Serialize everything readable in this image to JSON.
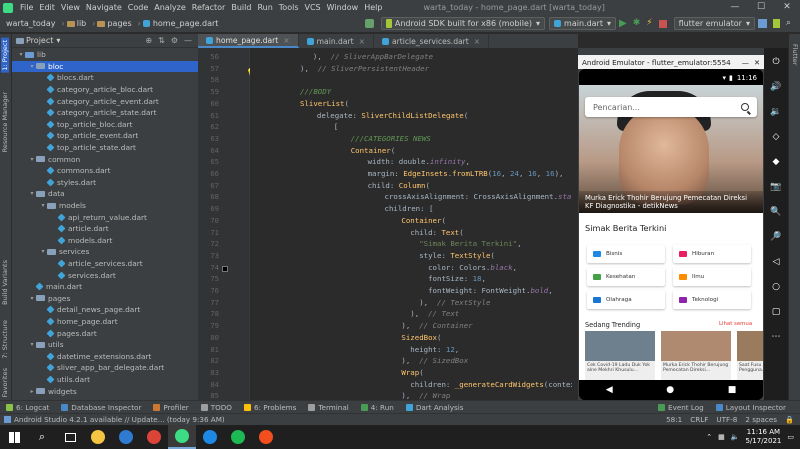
{
  "menu": {
    "items": [
      "File",
      "Edit",
      "View",
      "Navigate",
      "Code",
      "Analyze",
      "Refactor",
      "Build",
      "Run",
      "Tools",
      "VCS",
      "Window",
      "Help"
    ],
    "window_title": "warta_today - home_page.dart [warta_today]",
    "win_min": "—",
    "win_max": "☐",
    "win_close": "✕"
  },
  "nav": {
    "crumbs": [
      "warta_today",
      "lib",
      "pages",
      "home_page.dart"
    ],
    "device": "Android SDK built for x86 (mobile)",
    "run_config": "main.dart",
    "flutter_device": "flutter emulator"
  },
  "left_strip": {
    "project": "1: Project",
    "resource": "Resource Manager",
    "build_variants": "Build Variants",
    "structure": "7: Structure",
    "favorites": "2: Favorites"
  },
  "project_panel": {
    "title": "Project",
    "tree": [
      {
        "label": "lib",
        "kind": "folder-src",
        "indent": 1,
        "arrow": "▾"
      },
      {
        "label": "bloc",
        "kind": "folder",
        "indent": 2,
        "arrow": "▾",
        "selected": true
      },
      {
        "label": "blocs.dart",
        "kind": "dart",
        "indent": 3
      },
      {
        "label": "category_article_bloc.dart",
        "kind": "dart",
        "indent": 3
      },
      {
        "label": "category_article_event.dart",
        "kind": "dart",
        "indent": 3
      },
      {
        "label": "category_article_state.dart",
        "kind": "dart",
        "indent": 3
      },
      {
        "label": "top_article_bloc.dart",
        "kind": "dart",
        "indent": 3
      },
      {
        "label": "top_article_event.dart",
        "kind": "dart",
        "indent": 3
      },
      {
        "label": "top_article_state.dart",
        "kind": "dart",
        "indent": 3
      },
      {
        "label": "common",
        "kind": "folder",
        "indent": 2,
        "arrow": "▾"
      },
      {
        "label": "commons.dart",
        "kind": "dart",
        "indent": 3
      },
      {
        "label": "styles.dart",
        "kind": "dart",
        "indent": 3
      },
      {
        "label": "data",
        "kind": "folder",
        "indent": 2,
        "arrow": "▾"
      },
      {
        "label": "models",
        "kind": "folder",
        "indent": 3,
        "arrow": "▾"
      },
      {
        "label": "api_return_value.dart",
        "kind": "dart",
        "indent": 4
      },
      {
        "label": "article.dart",
        "kind": "dart",
        "indent": 4
      },
      {
        "label": "models.dart",
        "kind": "dart",
        "indent": 4
      },
      {
        "label": "services",
        "kind": "folder",
        "indent": 3,
        "arrow": "▾"
      },
      {
        "label": "article_services.dart",
        "kind": "dart",
        "indent": 4
      },
      {
        "label": "services.dart",
        "kind": "dart",
        "indent": 4
      },
      {
        "label": "main.dart",
        "kind": "dart",
        "indent": 2
      },
      {
        "label": "pages",
        "kind": "folder",
        "indent": 2,
        "arrow": "▾"
      },
      {
        "label": "detail_news_page.dart",
        "kind": "dart",
        "indent": 3
      },
      {
        "label": "home_page.dart",
        "kind": "dart",
        "indent": 3
      },
      {
        "label": "pages.dart",
        "kind": "dart",
        "indent": 3
      },
      {
        "label": "utils",
        "kind": "folder",
        "indent": 2,
        "arrow": "▾"
      },
      {
        "label": "datetime_extensions.dart",
        "kind": "dart",
        "indent": 3
      },
      {
        "label": "sliver_app_bar_delegate.dart",
        "kind": "dart",
        "indent": 3
      },
      {
        "label": "utils.dart",
        "kind": "dart",
        "indent": 3
      },
      {
        "label": "widgets",
        "kind": "folder",
        "indent": 2,
        "arrow": "▸"
      }
    ]
  },
  "editor": {
    "tabs": [
      {
        "label": "home_page.dart",
        "active": true
      },
      {
        "label": "main.dart",
        "active": false
      },
      {
        "label": "article_services.dart",
        "active": false
      }
    ],
    "line_start": 56,
    "lines": [
      [
        [
          "  ),  ",
          ""
        ],
        [
          "// SliverAppBarDelegate",
          "c-cg"
        ]
      ],
      [
        [
          "),  ",
          ""
        ],
        [
          "// SliverPersistentHeader",
          "c-cg"
        ]
      ],
      [
        [
          "",
          ""
        ]
      ],
      [
        [
          "///BODY",
          "c-cm"
        ]
      ],
      [
        [
          "SliverList",
          "c-cls"
        ],
        [
          "(",
          ""
        ]
      ],
      [
        [
          "  delegate: ",
          ""
        ],
        [
          "SliverChildListDelegate",
          "c-cls"
        ],
        [
          "(",
          ""
        ]
      ],
      [
        [
          "    [",
          ""
        ]
      ],
      [
        [
          "      ",
          ""
        ],
        [
          "///CATEGORIES NEWS",
          "c-cm"
        ]
      ],
      [
        [
          "      ",
          ""
        ],
        [
          "Container",
          "c-cls"
        ],
        [
          "(",
          ""
        ]
      ],
      [
        [
          "        width: double.",
          ""
        ],
        [
          "infinity",
          "c-it"
        ],
        [
          ",",
          ""
        ]
      ],
      [
        [
          "        margin: ",
          ""
        ],
        [
          "EdgeInsets",
          "c-cls"
        ],
        [
          ".",
          ""
        ],
        [
          "fromLTRB",
          "c-cls"
        ],
        [
          "(",
          ""
        ],
        [
          "16",
          "c-num"
        ],
        [
          ", ",
          ""
        ],
        [
          "24",
          "c-num"
        ],
        [
          ", ",
          ""
        ],
        [
          "16",
          "c-num"
        ],
        [
          ", ",
          ""
        ],
        [
          "16",
          "c-num"
        ],
        [
          "),",
          ""
        ]
      ],
      [
        [
          "        child: ",
          ""
        ],
        [
          "Column",
          "c-cls"
        ],
        [
          "(",
          ""
        ]
      ],
      [
        [
          "          crossAxisAlignment: CrossAxisAlignment.",
          ""
        ],
        [
          "start",
          "c-it"
        ],
        [
          ",",
          ""
        ]
      ],
      [
        [
          "          children: [",
          ""
        ]
      ],
      [
        [
          "            ",
          ""
        ],
        [
          "Container",
          "c-cls"
        ],
        [
          "(",
          ""
        ]
      ],
      [
        [
          "              child: ",
          ""
        ],
        [
          "Text",
          "c-cls"
        ],
        [
          "(",
          ""
        ]
      ],
      [
        [
          "                ",
          ""
        ],
        [
          "\"Simak Berita Terkini\"",
          "c-str"
        ],
        [
          ",",
          ""
        ]
      ],
      [
        [
          "                style: ",
          ""
        ],
        [
          "TextStyle",
          "c-cls"
        ],
        [
          "(",
          ""
        ]
      ],
      [
        [
          "                  color: Colors.",
          ""
        ],
        [
          "black",
          "c-it"
        ],
        [
          ",",
          ""
        ]
      ],
      [
        [
          "                  fontSize: ",
          ""
        ],
        [
          "18",
          "c-num"
        ],
        [
          ",",
          ""
        ]
      ],
      [
        [
          "                  fontWeight: FontWeight.",
          ""
        ],
        [
          "bold",
          "c-it"
        ],
        [
          ",",
          ""
        ]
      ],
      [
        [
          "                ),  ",
          ""
        ],
        [
          "// TextStyle",
          "c-cg"
        ]
      ],
      [
        [
          "              ),  ",
          ""
        ],
        [
          "// Text",
          "c-cg"
        ]
      ],
      [
        [
          "            ),  ",
          ""
        ],
        [
          "// Container",
          "c-cg"
        ]
      ],
      [
        [
          "            ",
          ""
        ],
        [
          "SizedBox",
          "c-cls"
        ],
        [
          "(",
          ""
        ]
      ],
      [
        [
          "              height: ",
          ""
        ],
        [
          "12",
          "c-num"
        ],
        [
          ",",
          ""
        ]
      ],
      [
        [
          "            ),  ",
          ""
        ],
        [
          "// SizedBox",
          "c-cg"
        ]
      ],
      [
        [
          "            ",
          ""
        ],
        [
          "Wrap",
          "c-cls"
        ],
        [
          "(",
          ""
        ]
      ],
      [
        [
          "              children: ",
          ""
        ],
        [
          "_generateCardWidgets",
          "c-cls"
        ],
        [
          "(context, categories),",
          ""
        ]
      ],
      [
        [
          "            ),  ",
          ""
        ],
        [
          "// Wrap",
          "c-cg"
        ]
      ]
    ]
  },
  "emulator": {
    "window_title": "Android Emulator - flutter_emulator:5554",
    "time": "11:16",
    "search_placeholder": "Pencarian...",
    "hero_caption": "Murka Erick Thohir Berujung Pemecatan Direksi KF Diagnostika - detikNews",
    "section_title": "Simak Berita Terkini",
    "categories": [
      {
        "label": "Bisnis",
        "color": "#1e88e5"
      },
      {
        "label": "Hiburan",
        "color": "#e91e63"
      },
      {
        "label": "Kesehatan",
        "color": "#43a047"
      },
      {
        "label": "Ilmu",
        "color": "#fb8c00"
      },
      {
        "label": "Olahraga",
        "color": "#1976d2"
      },
      {
        "label": "Teknologi",
        "color": "#8e24aa"
      }
    ],
    "trending_title": "Sedang Trending",
    "trending_more": "Lihat semua",
    "trending": [
      {
        "caption": "Cek Covid-19 Ladu Duk Yok alne Mekhri Khusulu...",
        "color": "#6e7f8e"
      },
      {
        "caption": "Murka Erick Thohir Berujung Pemecatan Direksi...",
        "color": "#b08a70"
      },
      {
        "caption": "Saat Fusu Pengguna...",
        "color": "#9a7b5e"
      }
    ],
    "nav": {
      "back": "◀",
      "home": "●",
      "recent": "■"
    },
    "side_controls": [
      "⏻",
      "🔊",
      "🔉",
      "◇",
      "◆",
      "📷",
      "🔍",
      "🔎",
      "◁",
      "○",
      "▢",
      "⋯"
    ]
  },
  "bottom_tabs": [
    {
      "label": "6: Logcat",
      "color": "#8bc34a"
    },
    {
      "label": "Database Inspector",
      "color": "#4a88c7"
    },
    {
      "label": "Profiler",
      "color": "#cc7832"
    },
    {
      "label": "TODO",
      "color": "#9e9e9e"
    },
    {
      "label": "6: Problems",
      "color": "#ffc107"
    },
    {
      "label": "Terminal",
      "color": "#9e9e9e"
    },
    {
      "label": "4: Run",
      "color": "#499c54"
    },
    {
      "label": "Dart Analysis",
      "color": "#40a4d8"
    }
  ],
  "bottom_right_tabs": [
    {
      "label": "Event Log",
      "color": "#499c54"
    },
    {
      "label": "Layout Inspector",
      "color": "#4a88c7"
    }
  ],
  "status": {
    "message": "Android Studio 4.2.1 available // Update... (today 9:36 AM)",
    "position": "58:1",
    "line_sep": "CRLF",
    "encoding": "UTF-8",
    "indent": "2 spaces"
  },
  "taskbar": {
    "time": "11:16 AM",
    "date": "5/17/2021",
    "apps": [
      {
        "name": "windows",
        "color": "#ffffff"
      },
      {
        "name": "search",
        "color": "#ffffff"
      },
      {
        "name": "task-view",
        "color": "#ffffff"
      },
      {
        "name": "files",
        "color": "#f4c542"
      },
      {
        "name": "code",
        "color": "#2e7bcf"
      },
      {
        "name": "chrome",
        "color": "#db4437"
      },
      {
        "name": "android-studio",
        "color": "#3ddc84"
      },
      {
        "name": "app-blue",
        "color": "#1e88e5"
      },
      {
        "name": "spotify",
        "color": "#1db954"
      },
      {
        "name": "figma",
        "color": "#f24e1e"
      }
    ]
  }
}
